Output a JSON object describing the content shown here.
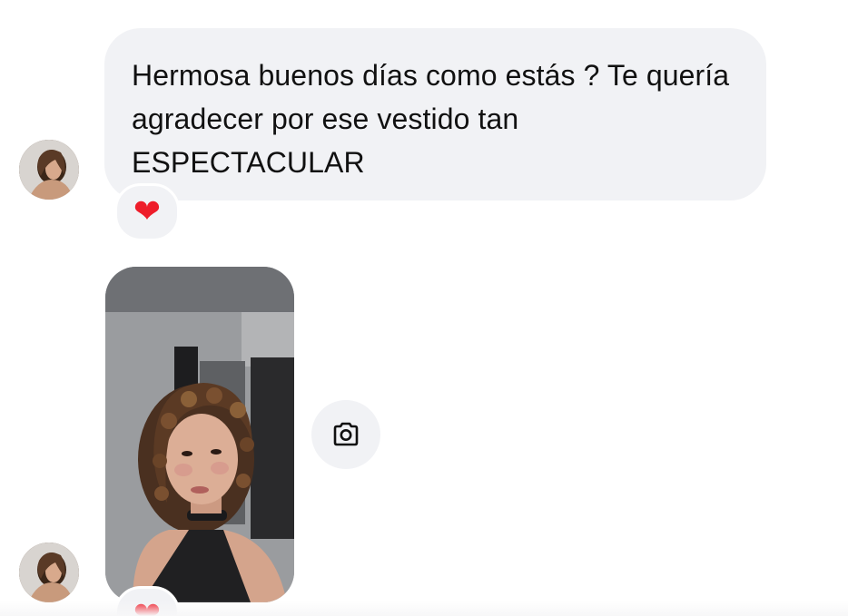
{
  "messages": [
    {
      "type": "text",
      "text": "Hermosa buenos días como estás ? Te quería agradecer por ese vestido tan ESPECTACULAR",
      "reaction": "❤"
    },
    {
      "type": "photo",
      "reaction": "❤",
      "action_icon": "camera-icon"
    }
  ],
  "colors": {
    "bubble": "#f1f2f5",
    "text": "#111111",
    "heart": "#ee1d2a",
    "background": "#ffffff"
  }
}
